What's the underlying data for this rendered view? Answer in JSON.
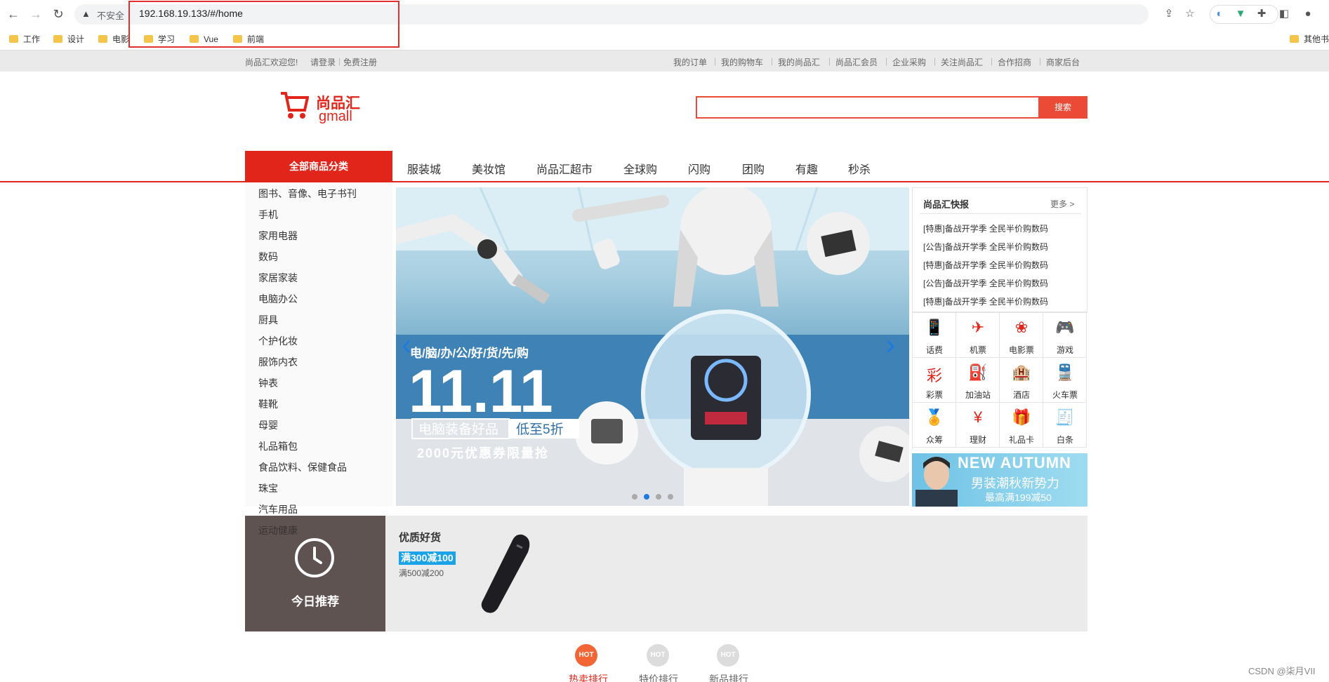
{
  "browser": {
    "insecure_label": "不安全",
    "url": "192.168.19.133/#/home",
    "bookmarks": [
      "工作",
      "设计",
      "电影",
      "学习",
      "Vue",
      "前端"
    ],
    "other_bookmarks": "其他书"
  },
  "topbar": {
    "welcome": "尚品汇欢迎您!",
    "login": "请登录",
    "register": "免费注册",
    "links": [
      "我的订单",
      "我的购物车",
      "我的尚品汇",
      "尚品汇会员",
      "企业采购",
      "关注尚品汇",
      "合作招商",
      "商家后台"
    ]
  },
  "header": {
    "logo_cn": "尚品汇",
    "logo_en": "gmall",
    "search_button": "搜索"
  },
  "nav": {
    "all_categories": "全部商品分类",
    "links": [
      "服装城",
      "美妆馆",
      "尚品汇超市",
      "全球购",
      "闪购",
      "团购",
      "有趣",
      "秒杀"
    ]
  },
  "categories": [
    "图书、音像、电子书刊",
    "手机",
    "家用电器",
    "数码",
    "家居家装",
    "电脑办公",
    "厨具",
    "个护化妆",
    "服饰内衣",
    "钟表",
    "鞋靴",
    "母婴",
    "礼品箱包",
    "食品饮料、保健食品",
    "珠宝",
    "汽车用品",
    "运动健康"
  ],
  "banner": {
    "tagline": "电/脑/办/公/好/货/先/购",
    "big": "11.11",
    "box_left": "电脑装备好品",
    "box_right": "低至5折",
    "coupon": "2000元优惠券限量抢",
    "active_dot": 1
  },
  "news": {
    "title": "尚品汇快报",
    "more": "更多 >",
    "items": [
      {
        "tag": "[特惠]",
        "text": "备战开学季 全民半价购数码"
      },
      {
        "tag": "[公告]",
        "text": "备战开学季 全民半价购数码"
      },
      {
        "tag": "[特惠]",
        "text": "备战开学季 全民半价购数码"
      },
      {
        "tag": "[公告]",
        "text": "备战开学季 全民半价购数码"
      },
      {
        "tag": "[特惠]",
        "text": "备战开学季 全民半价购数码"
      }
    ]
  },
  "services": [
    {
      "label": "话费",
      "icon": "phone-icon",
      "glyph": "📱"
    },
    {
      "label": "机票",
      "icon": "airplane-icon",
      "glyph": "✈"
    },
    {
      "label": "电影票",
      "icon": "film-icon",
      "glyph": "❀"
    },
    {
      "label": "游戏",
      "icon": "gamepad-icon",
      "glyph": "🎮"
    },
    {
      "label": "彩票",
      "icon": "lottery-icon",
      "glyph": "彩"
    },
    {
      "label": "加油站",
      "icon": "gas-station-icon",
      "glyph": "⛽"
    },
    {
      "label": "酒店",
      "icon": "hotel-icon",
      "glyph": "🏨"
    },
    {
      "label": "火车票",
      "icon": "train-icon",
      "glyph": "🚆"
    },
    {
      "label": "众筹",
      "icon": "crowdfunding-icon",
      "glyph": "🏅"
    },
    {
      "label": "理财",
      "icon": "finance-icon",
      "glyph": "¥"
    },
    {
      "label": "礼品卡",
      "icon": "gift-card-icon",
      "glyph": "🎁"
    },
    {
      "label": "白条",
      "icon": "credit-icon",
      "glyph": "🧾"
    }
  ],
  "ad": {
    "en": "NEW AUTUMN",
    "cn": "男装潮秋新势力",
    "sub": "最高满199减50"
  },
  "recommend": {
    "label": "今日推荐",
    "title": "优质好货",
    "badge": "满300减100",
    "sub": "满500减200"
  },
  "hot_tabs": [
    {
      "badge": "HOT",
      "label": "热卖排行",
      "active": true
    },
    {
      "badge": "HOT",
      "label": "特价排行",
      "active": false
    },
    {
      "badge": "HOT",
      "label": "新品排行",
      "active": false
    }
  ],
  "watermark": "CSDN @柒月VII",
  "colors": {
    "brand_red": "#e1251b",
    "search_red": "#ea4a36",
    "hot_orange": "#f26534"
  }
}
